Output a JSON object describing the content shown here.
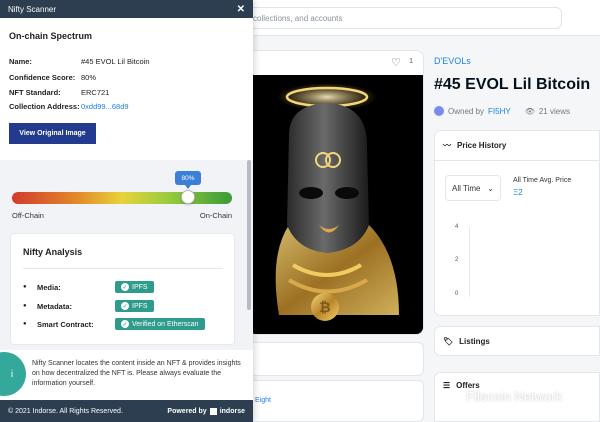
{
  "marketplace": {
    "search_placeholder": "collections, and accounts",
    "likes_count": "1",
    "collection_link": "D'EVOLs",
    "nft_title": "#45 EVOL Lil Bitcoin",
    "owned_by_label": "Owned by",
    "owner_name": "FI5HY",
    "views": "21 views",
    "price_history_label": "Price History",
    "time_filter": "All Time",
    "avg_price_label": "All Time Avg. Price",
    "avg_price_value": "Ξ2",
    "axis_ticks": [
      "4",
      "2",
      "0"
    ],
    "listings_label": "Listings",
    "offers_label": "Offers",
    "card_link_fragment": "Eight",
    "watermark": "Filecoin Network"
  },
  "scanner": {
    "title": "Nifty Scanner",
    "section_title": "On-chain Spectrum",
    "fields": [
      {
        "key": "Name:",
        "value": "#45 EVOL Lil Bitcoin"
      },
      {
        "key": "Confidence Score:",
        "value": "80%"
      },
      {
        "key": "NFT Standard:",
        "value": "ERC721"
      },
      {
        "key": "Collection Address:",
        "value": "0xdd99...68d9"
      }
    ],
    "view_button": "View Original Image",
    "spectrum": {
      "value_fraction": 0.8,
      "tooltip": "80%",
      "left_label": "Off-Chain",
      "right_label": "On-Chain"
    },
    "analysis_title": "Nifty Analysis",
    "analysis": [
      {
        "label": "Media:",
        "badge": "IPFS"
      },
      {
        "label": "Metadata:",
        "badge": "IPFS"
      },
      {
        "label": "Smart Contract:",
        "badge": "Verified on Etherscan"
      }
    ],
    "info_text": "Nifty Scanner locates the content inside an NFT & provides insights on how decentralized the NFT is. Please always evaluate the information yourself.",
    "footer_copyright": "© 2021 Indorse. All Rights Reserved.",
    "powered_by": "Powered by",
    "brand": "indorse"
  },
  "colors": {
    "panel_header": "#2c3e4f",
    "button": "#223b8f",
    "badge": "#2e9b8c",
    "link": "#2081e2",
    "tooltip": "#3b7fd6"
  }
}
